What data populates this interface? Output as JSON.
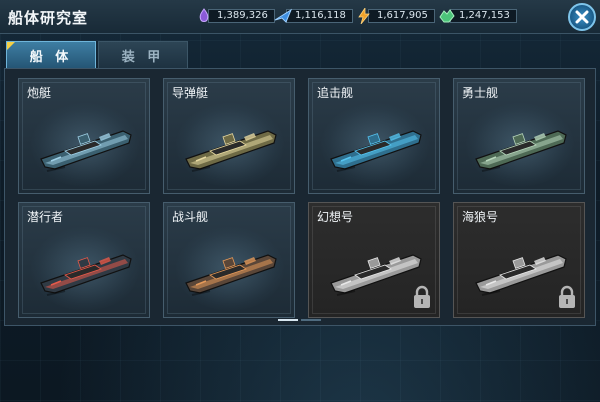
{
  "window": {
    "title": "船体研究室"
  },
  "resources": [
    {
      "icon": "purple-crystal-icon",
      "value": "1,389,326",
      "color": "#8a5ad8"
    },
    {
      "icon": "blue-wing-icon",
      "value": "1,116,118",
      "color": "#3f8fe0"
    },
    {
      "icon": "lightning-bolt-icon",
      "value": "1,617,905",
      "color": "#f0a22a"
    },
    {
      "icon": "green-gem-icon",
      "value": "1,247,153",
      "color": "#4cc47a"
    }
  ],
  "tabs": [
    {
      "label": "船 体",
      "active": true
    },
    {
      "label": "装 甲",
      "active": false
    }
  ],
  "ships": [
    {
      "name": "炮艇",
      "locked": false,
      "hull": "#3b6070",
      "accent": "#9fd0e6"
    },
    {
      "name": "导弹艇",
      "locked": false,
      "hull": "#6e6a45",
      "accent": "#e6d8a0"
    },
    {
      "name": "追击舰",
      "locked": false,
      "hull": "#2f6f8e",
      "accent": "#56c4f0"
    },
    {
      "name": "勇士舰",
      "locked": false,
      "hull": "#4e6a55",
      "accent": "#b7d6bb"
    },
    {
      "name": "潜行者",
      "locked": false,
      "hull": "#303a44",
      "accent": "#e65a4a"
    },
    {
      "name": "战斗舰",
      "locked": false,
      "hull": "#5a4638",
      "accent": "#e59a5a"
    },
    {
      "name": "幻想号",
      "locked": true,
      "hull": "#9a9a9a",
      "accent": "#e8e8e8"
    },
    {
      "name": "海狼号",
      "locked": true,
      "hull": "#9a9a9a",
      "accent": "#e8e8e8"
    }
  ],
  "pager": {
    "current": 1,
    "total": 2
  }
}
